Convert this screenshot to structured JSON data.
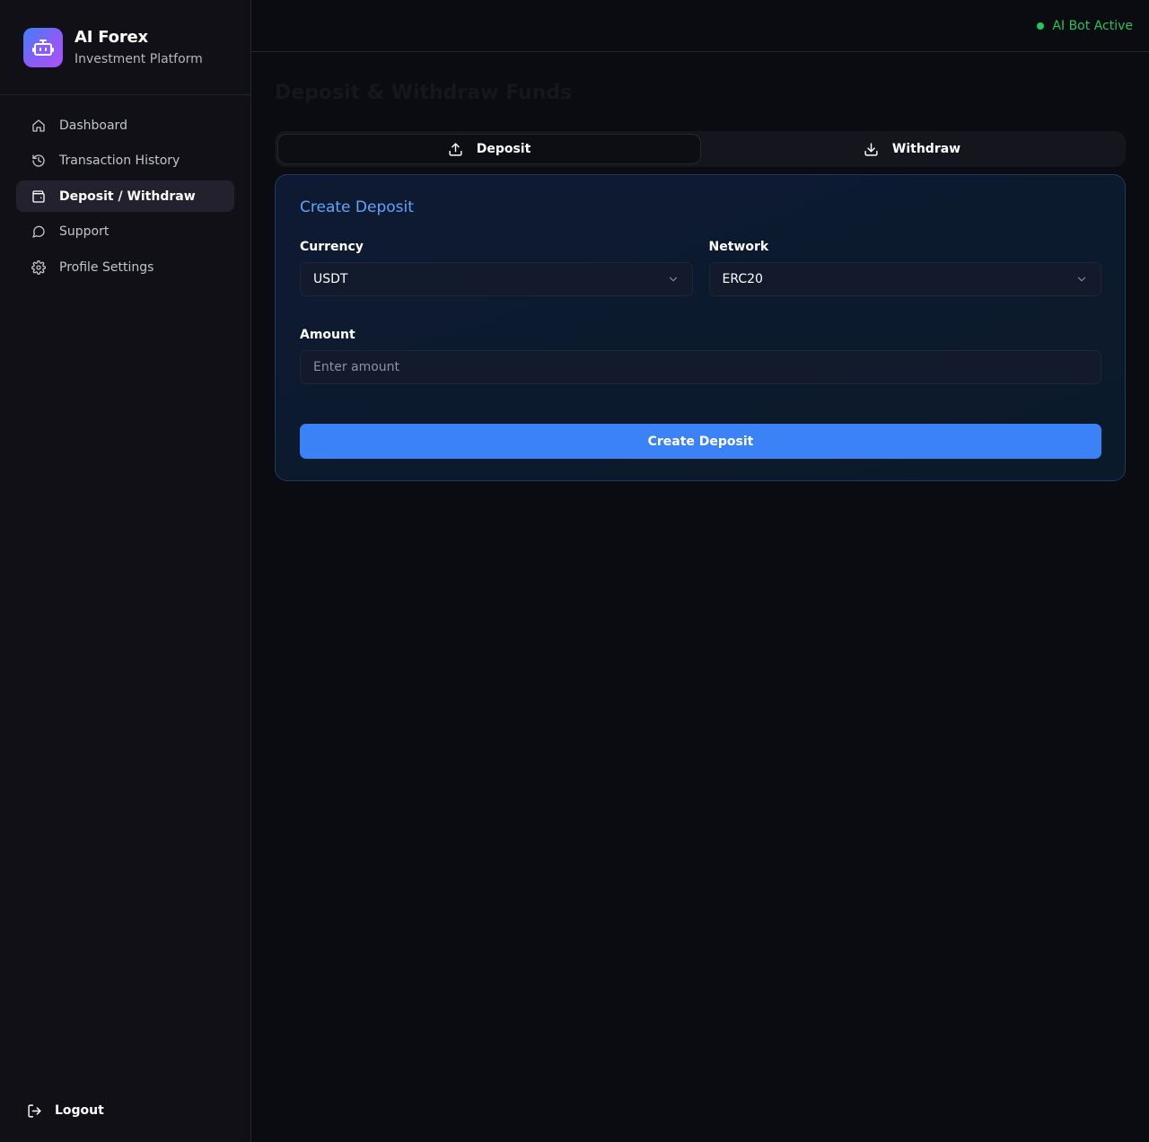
{
  "brand": {
    "title": "AI Forex",
    "subtitle": "Investment Platform",
    "logo_icon": "robot-icon"
  },
  "nav": {
    "items": [
      {
        "label": "Dashboard",
        "icon": "home-icon",
        "active": false
      },
      {
        "label": "Transaction History",
        "icon": "history-icon",
        "active": false
      },
      {
        "label": "Deposit / Withdraw",
        "icon": "wallet-icon",
        "active": true
      },
      {
        "label": "Support",
        "icon": "chat-bubble-icon",
        "active": false
      },
      {
        "label": "Profile Settings",
        "icon": "gear-icon",
        "active": false
      }
    ],
    "logout_label": "Logout"
  },
  "topbar": {
    "status_text": "AI Bot Active",
    "status_color": "#22c55e"
  },
  "page": {
    "title": "Deposit & Withdraw Funds"
  },
  "tabs": [
    {
      "label": "Deposit",
      "icon": "upload-icon",
      "active": true
    },
    {
      "label": "Withdraw",
      "icon": "download-icon",
      "active": false
    }
  ],
  "form": {
    "title": "Create Deposit",
    "currency": {
      "label": "Currency",
      "value": "USDT"
    },
    "network": {
      "label": "Network",
      "value": "ERC20"
    },
    "amount": {
      "label": "Amount",
      "placeholder": "Enter amount",
      "value": ""
    },
    "submit_label": "Create Deposit"
  },
  "colors": {
    "accent": "#3b82f6",
    "card_title": "#60a5fa",
    "active_status": "#22c55e"
  }
}
